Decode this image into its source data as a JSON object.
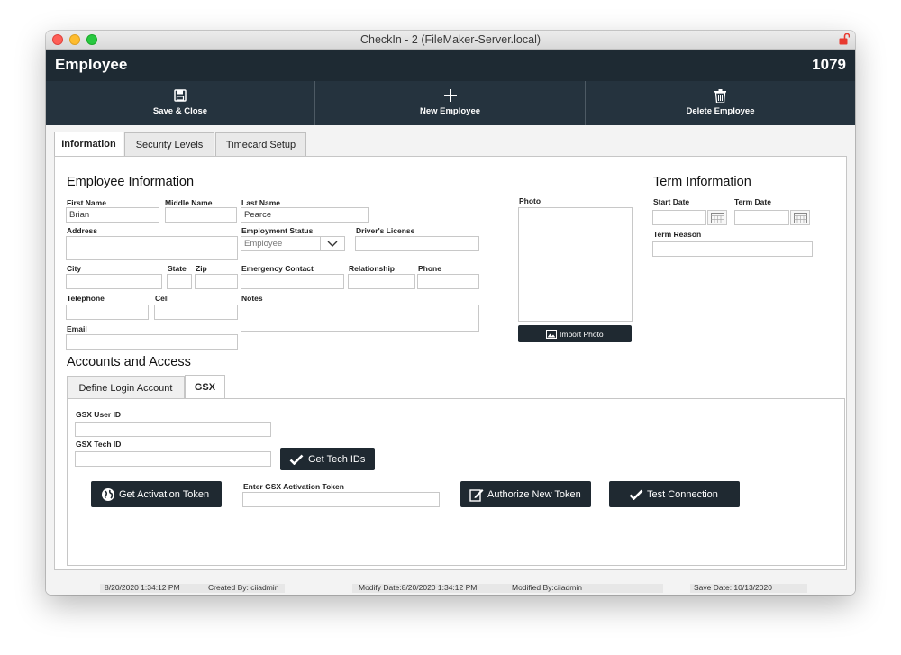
{
  "window": {
    "title": "CheckIn - 2 (FileMaker-Server.local)"
  },
  "header": {
    "title": "Employee",
    "record_number": "1079"
  },
  "toolbar": {
    "save_close": "Save & Close",
    "new_employee": "New Employee",
    "delete_employee": "Delete Employee"
  },
  "tabs": {
    "information": "Information",
    "security": "Security Levels",
    "timecard": "Timecard Setup"
  },
  "employee": {
    "heading": "Employee Information",
    "first_name_label": "First Name",
    "first_name": "Brian",
    "middle_name_label": "Middle Name",
    "middle_name": "",
    "last_name_label": "Last Name",
    "last_name": "Pearce",
    "address_label": "Address",
    "employment_status_label": "Employment Status",
    "employment_status": "Employee",
    "drivers_license_label": "Driver's License",
    "city_label": "City",
    "state_label": "State",
    "zip_label": "Zip",
    "emergency_contact_label": "Emergency Contact",
    "relationship_label": "Relationship",
    "phone_label": "Phone",
    "telephone_label": "Telephone",
    "cell_label": "Cell",
    "notes_label": "Notes",
    "email_label": "Email",
    "photo_label": "Photo",
    "import_photo": "Import Photo"
  },
  "term": {
    "heading": "Term Information",
    "start_date_label": "Start Date",
    "term_date_label": "Term Date",
    "term_reason_label": "Term Reason"
  },
  "accounts": {
    "heading": "Accounts and Access",
    "tab_login": "Define Login Account",
    "tab_gsx": "GSX",
    "gsx_user_id_label": "GSX User ID",
    "gsx_tech_id_label": "GSX Tech ID",
    "get_tech_ids": "Get Tech IDs",
    "get_activation_token": "Get Activation Token",
    "enter_token_label": "Enter GSX Activation Token",
    "authorize_new_token": "Authorize New Token",
    "test_connection": "Test Connection"
  },
  "footer": {
    "created_date": "8/20/2020 1:34:12 PM",
    "created_by": "Created By: ciiadmin",
    "modify_date": "Modify Date:8/20/2020 1:34:12 PM",
    "modified_by": "Modified By:ciiadmin",
    "save_date": "Save Date: 10/13/2020"
  },
  "colors": {
    "header_bg": "#1e2a33",
    "toolbar_bg": "#25333e",
    "button_dark": "#1f2931"
  }
}
